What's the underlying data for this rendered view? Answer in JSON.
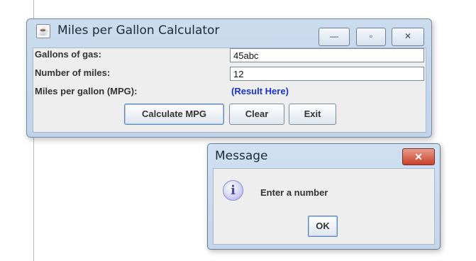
{
  "main_window": {
    "title": "Miles per Gallon Calculator",
    "controls": {
      "minimize": "—",
      "maximize": "▫",
      "close": "✕"
    },
    "fields": [
      {
        "label": "Gallons of gas:",
        "value": "45abc"
      },
      {
        "label": "Number of miles:",
        "value": "12"
      }
    ],
    "mpg_label": "Miles per gallon (MPG):",
    "mpg_result": "(Result Here)",
    "buttons": {
      "calculate": "Calculate MPG",
      "clear": "Clear",
      "exit": "Exit"
    }
  },
  "dialog": {
    "title": "Message",
    "close": "✕",
    "icon": "info-icon",
    "icon_glyph": "i",
    "message": "Enter a number",
    "ok": "OK"
  }
}
